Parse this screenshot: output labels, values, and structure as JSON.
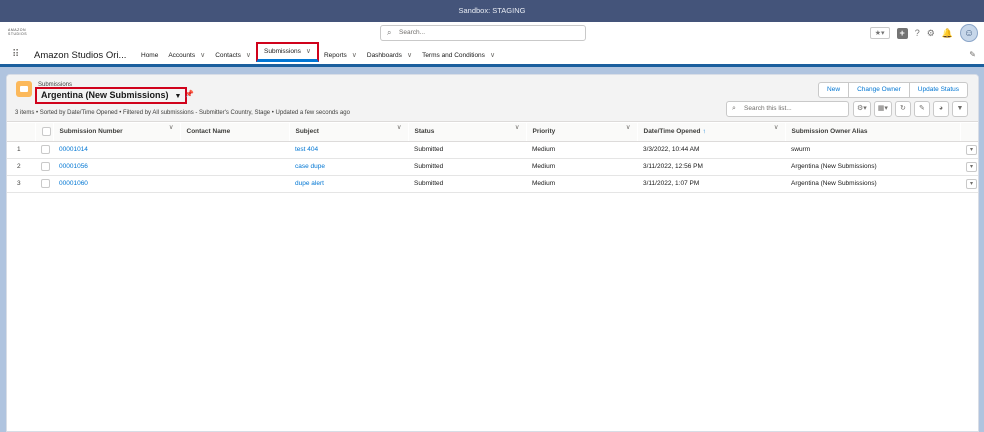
{
  "sandbox_banner": "Sandbox: STAGING",
  "header": {
    "logo_text": "AMAZON STUDIOS",
    "search_placeholder": "Search..."
  },
  "nav": {
    "app_name": "Amazon Studios Ori...",
    "items": [
      {
        "label": "Home",
        "has_menu": false
      },
      {
        "label": "Accounts",
        "has_menu": true
      },
      {
        "label": "Contacts",
        "has_menu": true
      },
      {
        "label": "Submissions",
        "has_menu": true,
        "active": true
      },
      {
        "label": "Reports",
        "has_menu": true
      },
      {
        "label": "Dashboards",
        "has_menu": true
      },
      {
        "label": "Terms and Conditions",
        "has_menu": true
      }
    ]
  },
  "list_view": {
    "object_label": "Submissions",
    "view_name": "Argentina (New Submissions)",
    "summary": "3 items • Sorted by Date/Time Opened • Filtered by All submissions - Submitter's Country, Stage • Updated a few seconds ago",
    "buttons": [
      "New",
      "Change Owner",
      "Update Status"
    ],
    "search_placeholder": "Search this list...",
    "columns": [
      "Submission Number",
      "Contact Name",
      "Subject",
      "Status",
      "Priority",
      "Date/Time Opened",
      "Submission Owner Alias"
    ],
    "sorted_column": "Date/Time Opened",
    "rows": [
      {
        "n": "1",
        "number": "00001014",
        "contact": "",
        "subject": "test 404",
        "status": "Submitted",
        "priority": "Medium",
        "opened": "3/3/2022, 10:44 AM",
        "owner": "swurm"
      },
      {
        "n": "2",
        "number": "00001056",
        "contact": "",
        "subject": "case dupe",
        "status": "Submitted",
        "priority": "Medium",
        "opened": "3/11/2022, 12:56 PM",
        "owner": "Argentina (New Submissions)"
      },
      {
        "n": "3",
        "number": "00001060",
        "contact": "",
        "subject": "dupe alert",
        "status": "Submitted",
        "priority": "Medium",
        "opened": "3/11/2022, 1:07 PM",
        "owner": "Argentina (New Submissions)"
      }
    ]
  }
}
